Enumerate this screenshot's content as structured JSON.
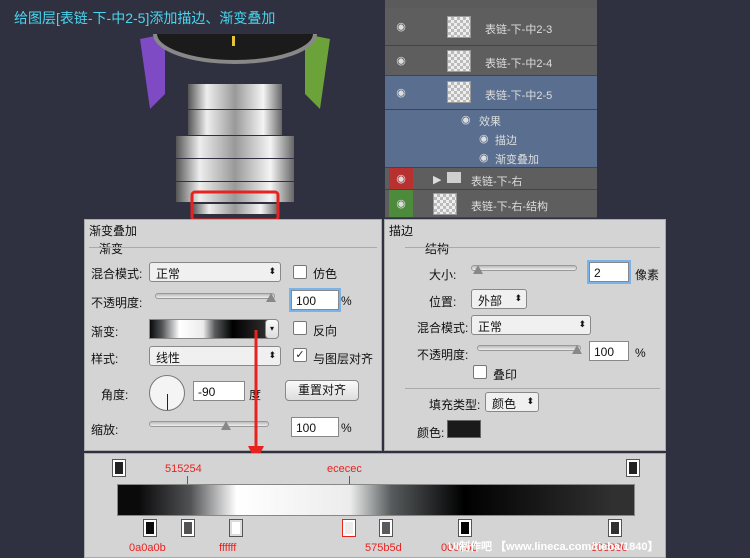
{
  "caption": "给图层[表链-下-中2-5]添加描边、渐变叠加",
  "layers": {
    "rows": [
      {
        "name": "表链-下-中2-3",
        "eye": "◉"
      },
      {
        "name": "表链-下-中2-4",
        "eye": "◉"
      },
      {
        "name": "表链-下-中2-5",
        "eye": "◉"
      },
      {
        "name": "效果",
        "eye": "◉"
      },
      {
        "name": "描边",
        "eye": "◉"
      },
      {
        "name": "渐变叠加",
        "eye": "◉"
      },
      {
        "name": "表链-下-右",
        "eye": "◉"
      },
      {
        "name": "表链-下-右-结构",
        "eye": "◉"
      }
    ]
  },
  "gradient_panel": {
    "title": "渐变叠加",
    "section": "渐变",
    "blend_label": "混合模式:",
    "blend_value": "正常",
    "dither_label": "仿色",
    "opacity_label": "不透明度:",
    "opacity_value": "100",
    "pct": "%",
    "gradient_label": "渐变:",
    "reverse_label": "反向",
    "style_label": "样式:",
    "style_value": "线性",
    "align_label": "与图层对齐",
    "angle_label": "角度:",
    "angle_value": "-90",
    "degree": "度",
    "reset_label": "重置对齐",
    "scale_label": "缩放:",
    "scale_value": "100"
  },
  "stroke_panel": {
    "title": "描边",
    "section": "结构",
    "size_label": "大小:",
    "size_value": "2",
    "px": "像素",
    "pos_label": "位置:",
    "pos_value": "外部",
    "blend_label": "混合模式:",
    "blend_value": "正常",
    "opacity_label": "不透明度:",
    "opacity_value": "100",
    "pct": "%",
    "overprint_label": "叠印",
    "fill_type_label": "填充类型:",
    "fill_type_value": "颜色",
    "color_label": "颜色:"
  },
  "editor": {
    "labels_top": [
      "515254",
      "ececec"
    ],
    "labels_bottom": [
      "0a0a0b",
      "ffffff",
      "575b5d",
      "000000",
      "303030"
    ]
  },
  "watermark": "UI制作吧 【www.lineca.com/tieba/1840】",
  "colors": {
    "stroke": "#1a1a1a",
    "accent_red": "#e8231f",
    "caption": "#49d6ee"
  }
}
